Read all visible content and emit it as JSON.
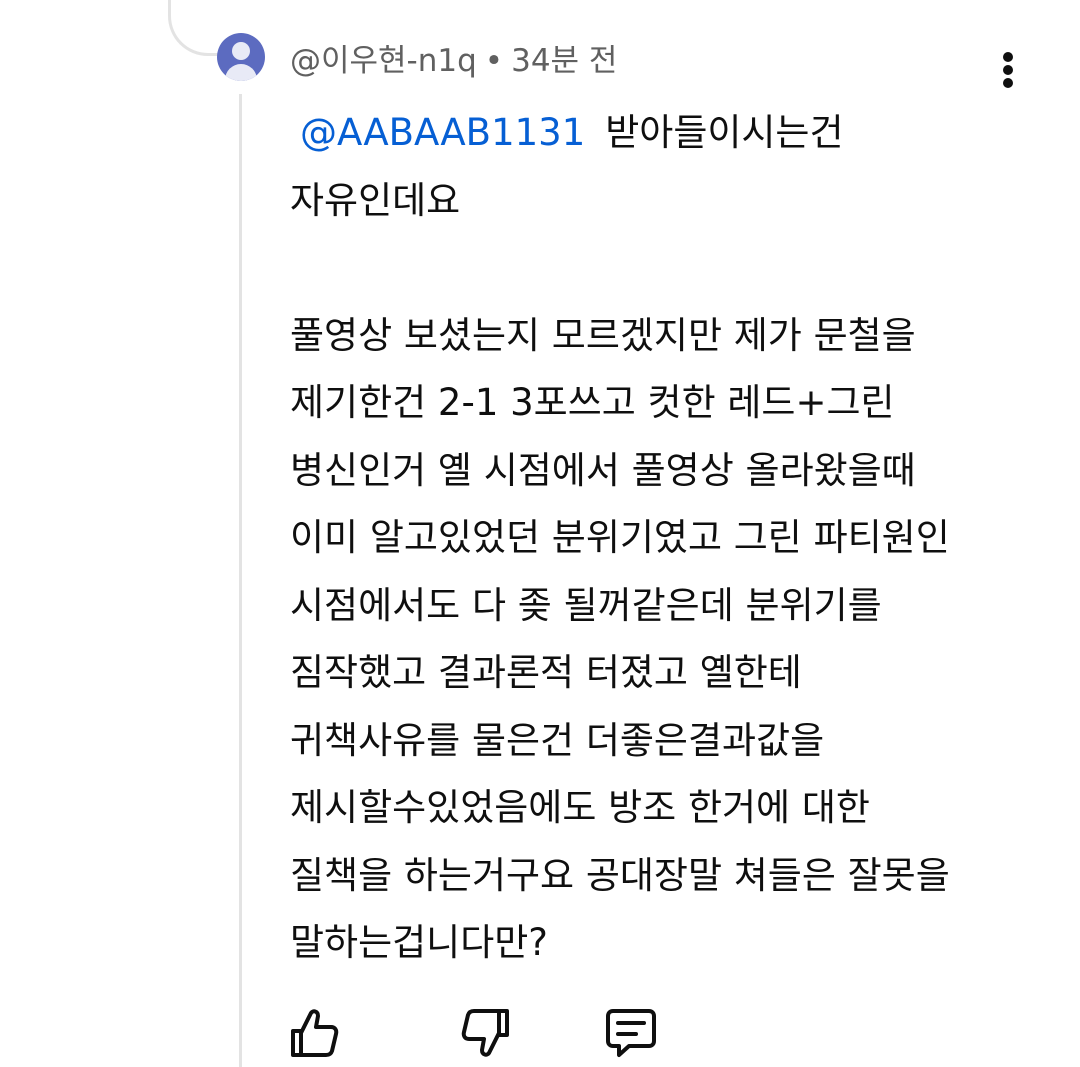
{
  "comment": {
    "author": "@이우현-n1q",
    "separator": "•",
    "time": "34분 전",
    "mention": "@AABAAB1131",
    "lines": [
      "받아들이시는건",
      "자유인데요",
      "",
      "풀영상 보셨는지 모르겠지만 제가 문철을",
      "제기한건 2-1 3포쓰고 컷한 레드+그린",
      "병신인거 옐 시점에서 풀영상 올라왔을때",
      "이미 알고있었던 분위기였고 그린 파티원인",
      "시점에서도 다 좆 될꺼같은데 분위기를",
      "짐작했고 결과론적 터졌고 옐한테",
      "귀책사유를 물은건 더좋은결과값을",
      "제시할수있었음에도 방조 한거에  대한",
      "질책을 하는거구요 공대장말 쳐들은 잘못을",
      "말하는겁니다만?"
    ]
  },
  "actions": {
    "like_icon": "thumb-up-icon",
    "dislike_icon": "thumb-down-icon",
    "reply_icon": "comment-icon",
    "more_icon": "more-vertical-icon"
  },
  "colors": {
    "mention": "#065fd4",
    "meta": "#606060",
    "avatar": "#5c6bc0",
    "thread_line": "#e3e3e3"
  }
}
